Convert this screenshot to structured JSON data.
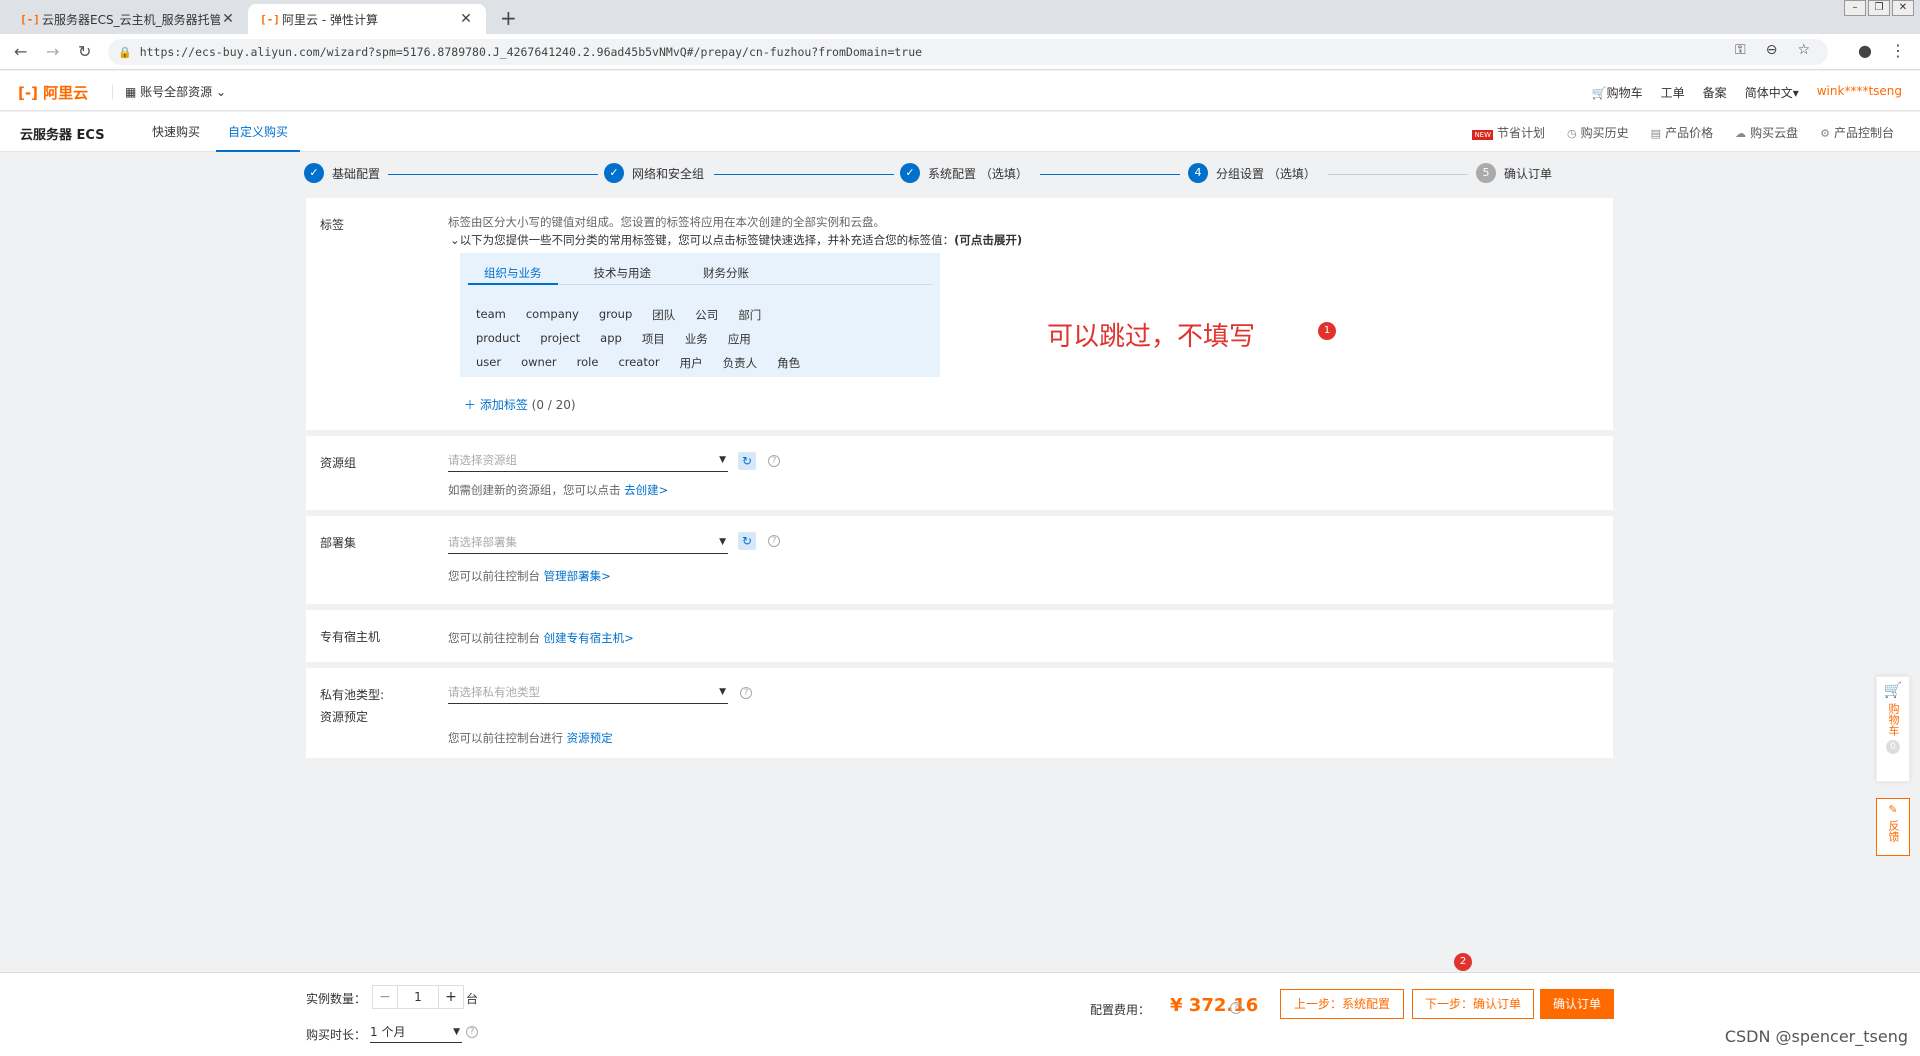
{
  "browser": {
    "tabs": [
      {
        "label": "云服务器ECS_云主机_服务器托管",
        "favicon": "[-]"
      },
      {
        "label": "阿里云 - 弹性计算",
        "favicon": "[-]"
      }
    ],
    "url": "https://ecs-buy.aliyun.com/wizard?spm=5176.8789780.J_4267641240.2.96ad45b5vNMvQ#/prepay/cn-fuzhou?fromDomain=true"
  },
  "header": {
    "logo": "阿里云",
    "account_switch": "账号全部资源",
    "cart": "购物车",
    "ticket": "工单",
    "filing": "备案",
    "language": "简体中文",
    "user": "wink****tseng"
  },
  "subnav": {
    "product": "云服务器 ECS",
    "tabs": [
      "快速购买",
      "自定义购买"
    ],
    "new_badge": "NEW",
    "right": [
      "节省计划",
      "购买历史",
      "产品价格",
      "购买云盘",
      "产品控制台"
    ]
  },
  "steps": [
    {
      "num": "✓",
      "label": "基础配置"
    },
    {
      "num": "✓",
      "label": "网络和安全组"
    },
    {
      "num": "✓",
      "label": "系统配置 （选填）"
    },
    {
      "num": "4",
      "label": "分组设置 （选填）"
    },
    {
      "num": "5",
      "label": "确认订单"
    }
  ],
  "tags": {
    "label": "标签",
    "desc": "标签由区分大小写的键值对组成。您设置的标签将应用在本次创建的全部实例和云盘。",
    "expand_prefix": "以下为您提供一些不同分类的常用标签键，您可以点击标签键快速选择，并补充适合您的标签值：",
    "expand_bold": "(可点击展开)",
    "tabs": [
      "组织与业务",
      "技术与用途",
      "财务分账"
    ],
    "row1": [
      "team",
      "company",
      "group",
      "团队",
      "公司",
      "部门"
    ],
    "row2": [
      "product",
      "project",
      "app",
      "项目",
      "业务",
      "应用"
    ],
    "row3": [
      "user",
      "owner",
      "role",
      "creator",
      "用户",
      "负责人",
      "角色"
    ],
    "add_label": "添加标签",
    "count": "(0 / 20)"
  },
  "resource_group": {
    "label": "资源组",
    "placeholder": "请选择资源组",
    "hint_prefix": "如需创建新的资源组，您可以点击",
    "hint_link": "去创建>"
  },
  "deployment_set": {
    "label": "部署集",
    "placeholder": "请选择部署集",
    "hint_prefix": "您可以前往控制台",
    "hint_link": "管理部署集>"
  },
  "dedicated_host": {
    "label": "专有宿主机",
    "hint_prefix": "您可以前往控制台",
    "hint_link": "创建专有宿主机>"
  },
  "private_pool": {
    "label": "私有池类型:",
    "sublabel": "资源预定",
    "placeholder": "请选择私有池类型",
    "hint_prefix": "您可以前往控制台进行",
    "hint_link": "资源预定"
  },
  "annotation": {
    "text": "可以跳过，不填写",
    "badge1": "1",
    "badge2": "2"
  },
  "float": {
    "cart": "购物车",
    "cart_count": "0",
    "feedback": "反馈"
  },
  "footer": {
    "qty_label": "实例数量：",
    "qty_value": "1",
    "qty_unit": "台",
    "duration_label": "购买时长：",
    "duration_value": "1 个月",
    "price_label": "配置费用：",
    "price": "¥ 372.16",
    "btn_prev": "上一步：系统配置",
    "btn_next": "下一步：确认订单",
    "btn_confirm": "确认订单"
  },
  "watermark": "CSDN @spencer_tseng",
  "colors": {
    "accent": "#ff6a00",
    "primary": "#0070cc",
    "annotation": "#e0332c"
  }
}
